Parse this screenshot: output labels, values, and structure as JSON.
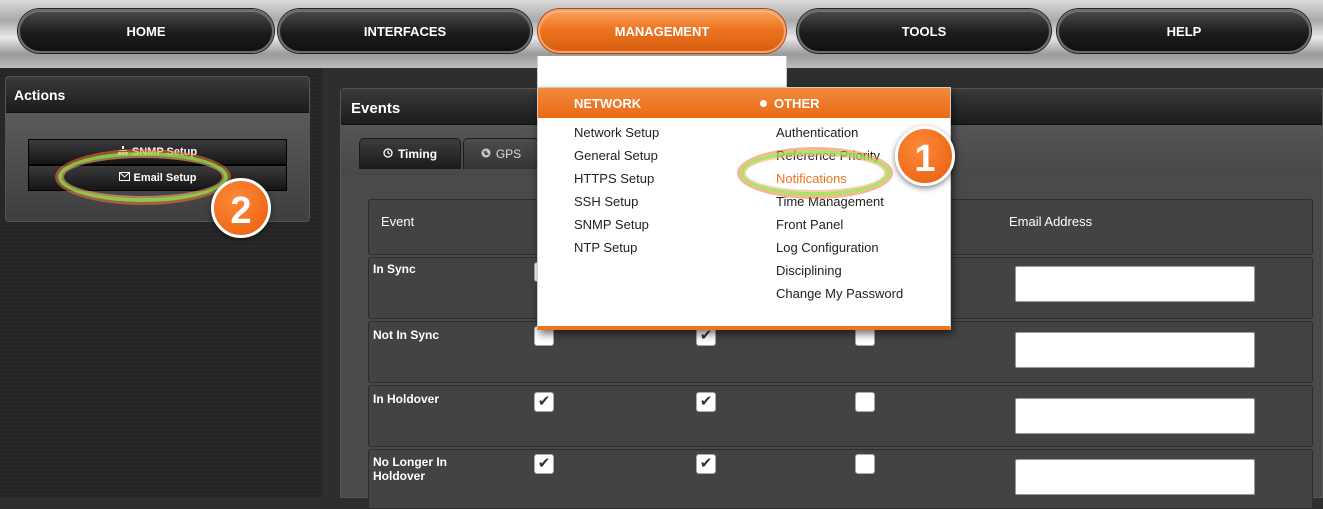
{
  "nav": {
    "items": [
      {
        "label": "HOME"
      },
      {
        "label": "INTERFACES"
      },
      {
        "label": "MANAGEMENT"
      },
      {
        "label": "TOOLS"
      },
      {
        "label": "HELP"
      }
    ],
    "active": "MANAGEMENT"
  },
  "actions": {
    "title": "Actions",
    "buttons": [
      {
        "label": "SNMP Setup",
        "icon": "sitemap-icon"
      },
      {
        "label": "Email Setup",
        "icon": "envelope-icon"
      }
    ]
  },
  "events": {
    "title": "Events",
    "tabs": [
      {
        "label": "Timing",
        "icon": "clock-icon",
        "active": true
      },
      {
        "label": "GPS",
        "icon": "globe-icon",
        "active": false
      }
    ],
    "columns": {
      "event": "Event",
      "email": "Email Address"
    },
    "rows": [
      {
        "label": "In Sync",
        "checks": [
          false,
          false,
          false
        ],
        "email": ""
      },
      {
        "label": "Not In Sync",
        "checks": [
          false,
          true,
          false
        ],
        "email": ""
      },
      {
        "label": "In Holdover",
        "checks": [
          true,
          true,
          false
        ],
        "email": ""
      },
      {
        "label": "No Longer In Holdover",
        "checks": [
          true,
          true,
          false
        ],
        "email": ""
      }
    ]
  },
  "dropdown": {
    "network": {
      "title": "NETWORK",
      "items": [
        "Network Setup",
        "General Setup",
        "HTTPS Setup",
        "SSH Setup",
        "SNMP Setup",
        "NTP Setup"
      ]
    },
    "other": {
      "title": "OTHER",
      "items": [
        "Authentication",
        "Reference Priority",
        "Notifications",
        "Time Management",
        "Front Panel",
        "Log Configuration",
        "Disciplining",
        "Change My Password"
      ],
      "highlighted": "Notifications"
    }
  },
  "callouts": {
    "step1": "1",
    "step2": "2"
  },
  "colors": {
    "accent": "#ee7420",
    "panel": "#3c3c3c",
    "ring": "#a0dc50"
  }
}
